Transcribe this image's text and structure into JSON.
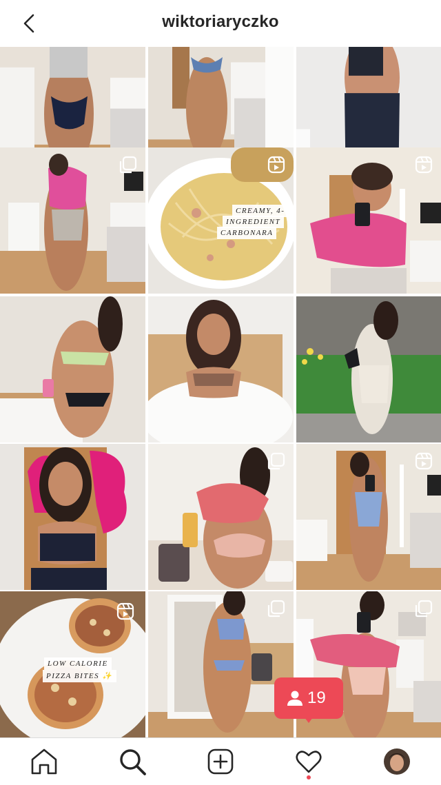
{
  "header": {
    "username": "wiktoriaryczko",
    "back_icon": "chevron-left-icon"
  },
  "grid": {
    "posts": [
      {
        "id": "p1",
        "type": "photo",
        "caption_lines": []
      },
      {
        "id": "p2",
        "type": "photo",
        "caption_lines": []
      },
      {
        "id": "p3",
        "type": "photo",
        "caption_lines": []
      },
      {
        "id": "p4",
        "type": "carousel",
        "caption_lines": []
      },
      {
        "id": "p5",
        "type": "reel",
        "caption_lines": [
          "CREAMY, 4-",
          "INGREDIENT",
          "CARBONARA"
        ]
      },
      {
        "id": "p6",
        "type": "reel",
        "caption_lines": []
      },
      {
        "id": "p7",
        "type": "photo",
        "caption_lines": []
      },
      {
        "id": "p8",
        "type": "photo",
        "caption_lines": []
      },
      {
        "id": "p9",
        "type": "photo",
        "caption_lines": []
      },
      {
        "id": "p10",
        "type": "photo",
        "caption_lines": []
      },
      {
        "id": "p11",
        "type": "carousel",
        "caption_lines": []
      },
      {
        "id": "p12",
        "type": "reel",
        "caption_lines": []
      },
      {
        "id": "p13",
        "type": "reel",
        "caption_lines": [
          "LOW CALORIE",
          "PIZZA BITES ✨"
        ]
      },
      {
        "id": "p14",
        "type": "carousel",
        "caption_lines": []
      },
      {
        "id": "p15",
        "type": "carousel",
        "caption_lines": []
      }
    ]
  },
  "notification": {
    "count": "19",
    "icon": "person-icon",
    "color": "#ed4956"
  },
  "bottom_nav": {
    "items": [
      "home-icon",
      "search-icon",
      "new-post-icon",
      "activity-heart-icon",
      "profile-avatar"
    ],
    "active": "search-icon",
    "indicator_color": "#ed4956"
  }
}
